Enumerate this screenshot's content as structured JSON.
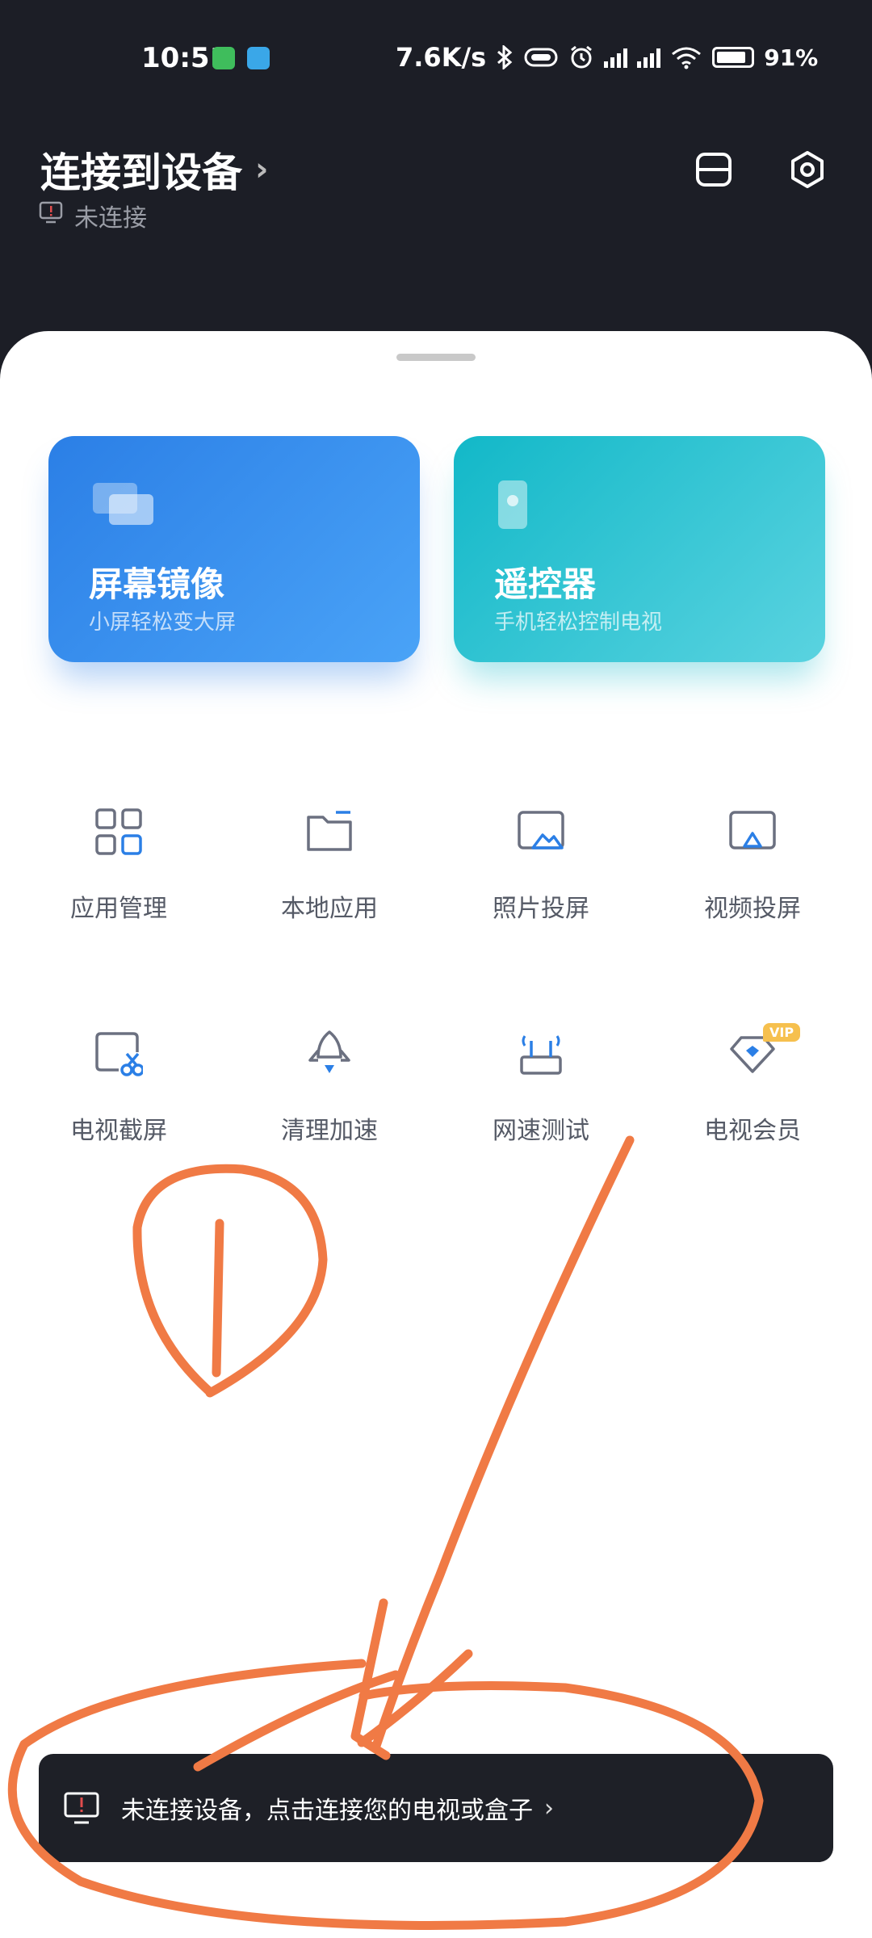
{
  "status_bar": {
    "time": "10:51",
    "net_speed": "7.6K/s",
    "battery": "91%"
  },
  "header": {
    "title": "连接到设备",
    "status": "未连接"
  },
  "cards": [
    {
      "title": "屏幕镜像",
      "subtitle": "小屏轻松变大屏"
    },
    {
      "title": "遥控器",
      "subtitle": "手机轻松控制电视"
    }
  ],
  "grid": [
    {
      "label": "应用管理",
      "icon": "apps-grid-icon"
    },
    {
      "label": "本地应用",
      "icon": "folder-icon"
    },
    {
      "label": "照片投屏",
      "icon": "photo-cast-icon"
    },
    {
      "label": "视频投屏",
      "icon": "video-cast-icon"
    },
    {
      "label": "电视截屏",
      "icon": "screenshot-icon"
    },
    {
      "label": "清理加速",
      "icon": "rocket-icon"
    },
    {
      "label": "网速测试",
      "icon": "router-icon"
    },
    {
      "label": "电视会员",
      "icon": "vip-diamond-icon"
    }
  ],
  "vip_badge": "VIP",
  "bottom_bar": {
    "message": "未连接设备，点击连接您的电视或盒子"
  },
  "colors": {
    "dark_bg": "#1c1e26",
    "accent_blue": "#2b7fe6",
    "accent_teal": "#12b8c8",
    "annotation": "#f07a45"
  }
}
